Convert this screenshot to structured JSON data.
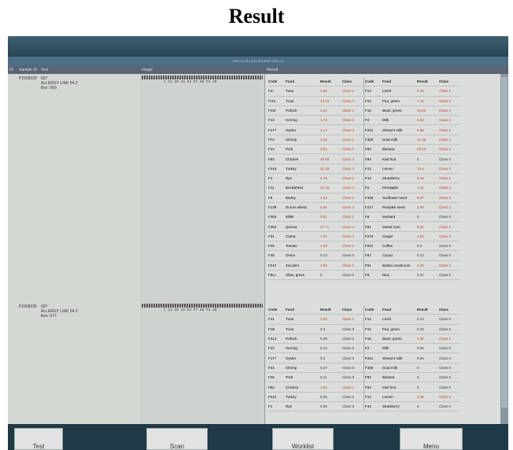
{
  "title": "Result",
  "header": {
    "status": "2023.10.15  14:47  ACCENT LINK 2.2",
    "columns": [
      "ID",
      "Sample ID",
      "Test",
      "Image",
      "Result"
    ]
  },
  "results_table_headers": {
    "code": "Code",
    "food": "Food",
    "result": "Result",
    "class": "Class"
  },
  "rows": [
    {
      "id": "",
      "sample_id": "P2308028",
      "test_code": "007",
      "test_name": "ALLERGY LINK 54.2",
      "test_sub": "Box: 055",
      "sequence": "1 23 30 43 64 P7 88 P1 AB",
      "left": [
        {
          "code": "Fm",
          "food": "Tuna",
          "result": "2.95",
          "class": "Class 2"
        },
        {
          "code": "Fr10",
          "food": "Trout",
          "result": "43.23",
          "class": "Class 4"
        },
        {
          "code": "Fr03",
          "food": "Pollock",
          "result": "2.21",
          "class": "Class 2"
        },
        {
          "code": "F13",
          "food": "Herring",
          "result": "1.74",
          "class": "Class 2"
        },
        {
          "code": "F177",
          "food": "Oyster",
          "result": "4.17",
          "class": "Class 3"
        },
        {
          "code": "F74",
          "food": "Shrimp",
          "result": "3.16",
          "class": "Class 2"
        },
        {
          "code": "F14",
          "food": "Pork",
          "result": "2.81",
          "class": "Class 2"
        },
        {
          "code": "F83",
          "food": "Chicken",
          "result": "46.56",
          "class": "Class 4"
        },
        {
          "code": "F243",
          "food": "Turkey",
          "result": "31.26",
          "class": "Class 4"
        },
        {
          "code": "F1",
          "food": "Rye",
          "result": "2.75",
          "class": "Class 2"
        },
        {
          "code": "F11",
          "food": "Buckwheat",
          "result": "31.19",
          "class": "Class 4"
        },
        {
          "code": "F6",
          "food": "Barley",
          "result": "1.01",
          "class": "Class 2"
        },
        {
          "code": "F139",
          "food": "Durum wheat",
          "result": "5.55",
          "class": "Class 3"
        },
        {
          "code": "F264",
          "food": "Millet",
          "result": "0.81",
          "class": "Class 1"
        },
        {
          "code": "F452",
          "food": "Quinoa",
          "result": "27.71",
          "class": "Class 4"
        },
        {
          "code": "F31",
          "food": "Carrot",
          "result": "7.21",
          "class": "Class 3"
        },
        {
          "code": "F25",
          "food": "Tomato",
          "result": "1.28",
          "class": "Class 2"
        },
        {
          "code": "F48",
          "food": "Onion",
          "result": "0.13",
          "class": "Class 0"
        },
        {
          "code": "F247",
          "food": "Zucchini",
          "result": "3.60",
          "class": "Class 2"
        },
        {
          "code": "F9LL",
          "food": "Olive, green",
          "result": "0",
          "class": "Class 0"
        }
      ],
      "right": [
        {
          "code": "F12",
          "food": "Lentil",
          "result": "2.44",
          "class": "Class 2"
        },
        {
          "code": "F12",
          "food": "Pea, green",
          "result": "7.19",
          "class": "Class 3"
        },
        {
          "code": "F15",
          "food": "Bean, green",
          "result": "43.52",
          "class": "Class 4"
        },
        {
          "code": "F2",
          "food": "Milk",
          "result": "3.03",
          "class": "Class 2"
        },
        {
          "code": "F221",
          "food": "Sheep's milk",
          "result": "0.85",
          "class": "Class 1"
        },
        {
          "code": "F300",
          "food": "Goat milk",
          "result": "41.45",
          "class": "Class 4"
        },
        {
          "code": "F92",
          "food": "Banana",
          "result": "29.10",
          "class": "Class 4"
        },
        {
          "code": "F84",
          "food": "Kiwi fruit",
          "result": "0",
          "class": "Class 0"
        },
        {
          "code": "F12",
          "food": "Lemon",
          "result": "73.4",
          "class": "Class 4"
        },
        {
          "code": "F44",
          "food": "Strawberry",
          "result": "0.43",
          "class": "Class 1"
        },
        {
          "code": "F2",
          "food": "Pineapple",
          "result": "1.12",
          "class": "Class 2"
        },
        {
          "code": "F336",
          "food": "Sunflower seed",
          "result": "6.07",
          "class": "Class 3"
        },
        {
          "code": "F217",
          "food": "Pumpkin seed",
          "result": "3.06",
          "class": "Class 2"
        },
        {
          "code": "F8",
          "food": "Mustard",
          "result": "0",
          "class": "Class 0"
        },
        {
          "code": "F81",
          "food": "Sweet corn",
          "result": "0.81",
          "class": "Class 1"
        },
        {
          "code": "F270",
          "food": "Ginger",
          "result": "1.50",
          "class": "Class 2"
        },
        {
          "code": "F221",
          "food": "Coffee",
          "result": "0.2",
          "class": "Class 0"
        },
        {
          "code": "F67",
          "food": "Cacao",
          "result": "0.14",
          "class": "Class 0"
        },
        {
          "code": "F61",
          "food": "Button mushroom",
          "result": "1.46",
          "class": "Class 2"
        },
        {
          "code": "F9",
          "food": "Rice",
          "result": "0.37",
          "class": "Class 0"
        }
      ]
    },
    {
      "id": "",
      "sample_id": "P2308036",
      "test_code": "007",
      "test_name": "ALLERGY LINK 54.2",
      "test_sub": "Box: 077",
      "sequence": "1 23 30 43 64 P7 88 P1 AB",
      "left": [
        {
          "code": "F41",
          "food": "Tuna",
          "result": "2.00",
          "class": "Class 2"
        },
        {
          "code": "F1B",
          "food": "Trout",
          "result": "0.3",
          "class": "Class 0"
        },
        {
          "code": "F413",
          "food": "Pollock",
          "result": "0.39",
          "class": "Class 0"
        },
        {
          "code": "F12",
          "food": "Herring",
          "result": "0.13",
          "class": "Class 0"
        },
        {
          "code": "F177",
          "food": "Oyster",
          "result": "0.2",
          "class": "Class 0"
        },
        {
          "code": "F24",
          "food": "Shrimp",
          "result": "0.27",
          "class": "Class 0"
        },
        {
          "code": "F25",
          "food": "Pork",
          "result": "0.11",
          "class": "Class 0"
        },
        {
          "code": "F83",
          "food": "Chicken",
          "result": "1.01",
          "class": "Class 2"
        },
        {
          "code": "F243",
          "food": "Turkey",
          "result": "0.26",
          "class": "Class 0"
        },
        {
          "code": "F1",
          "food": "Rye",
          "result": "0.05",
          "class": "Class 0"
        }
      ],
      "right": [
        {
          "code": "F12",
          "food": "Lentil",
          "result": "0.12",
          "class": "Class 0"
        },
        {
          "code": "F12",
          "food": "Pea, green",
          "result": "0.24",
          "class": "Class 0"
        },
        {
          "code": "F15",
          "food": "Bean, green",
          "result": "1.90",
          "class": "Class 2"
        },
        {
          "code": "F2",
          "food": "Milk",
          "result": "0.05",
          "class": "Class 0"
        },
        {
          "code": "F221",
          "food": "Sheep's milk",
          "result": "0.05",
          "class": "Class 0"
        },
        {
          "code": "F300",
          "food": "Goat milk",
          "result": "0",
          "class": "Class 0"
        },
        {
          "code": "F92",
          "food": "Banana",
          "result": "0",
          "class": "Class 0"
        },
        {
          "code": "F84",
          "food": "Kiwi fruit",
          "result": "0",
          "class": "Class 0"
        },
        {
          "code": "F12",
          "food": "Lemon",
          "result": "3.45",
          "class": "Class 2"
        },
        {
          "code": "F44",
          "food": "Strawberry",
          "result": "0",
          "class": "Class 0"
        }
      ]
    }
  ],
  "buttons": [
    "Test",
    "Scan",
    "Worklist",
    "Menu"
  ],
  "colors": {
    "positive": "#c0392b",
    "negative": "#333333",
    "screen_bg": "#2d4a56"
  }
}
